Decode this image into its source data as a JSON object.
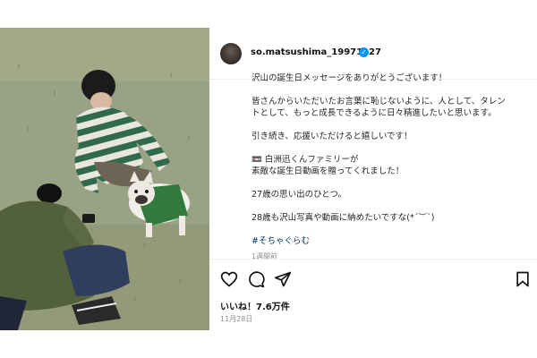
{
  "post": {
    "username": "so.matsushima_19971127",
    "verified_icon": "verified-badge-icon",
    "verified_color": "#0095f6",
    "caption_lines": [
      "沢山の誕生日メッセージをありがとうございます！",
      "皆さんからいただいたお言葉に恥じないように、人として、タレン",
      "トとして、もっと成長できるように日々精進したいと思います。",
      "引き続き、応援いただけると嬉しいです！",
      "📼 白洲迅くんファミリーが",
      "素敵な誕生日動画を贈ってくれました！",
      "27歳の思い出のひとつ。",
      "28歳も沢山写真や動画に納めたいですな(*´︶`)"
    ],
    "hashtag": "#そちゃぐらむ",
    "time_ago": "1週間前",
    "likes": "いいね！7.6万件",
    "date": "11月28日",
    "icons": [
      "heart-icon",
      "comment-icon",
      "share-icon",
      "bookmark-icon"
    ]
  }
}
